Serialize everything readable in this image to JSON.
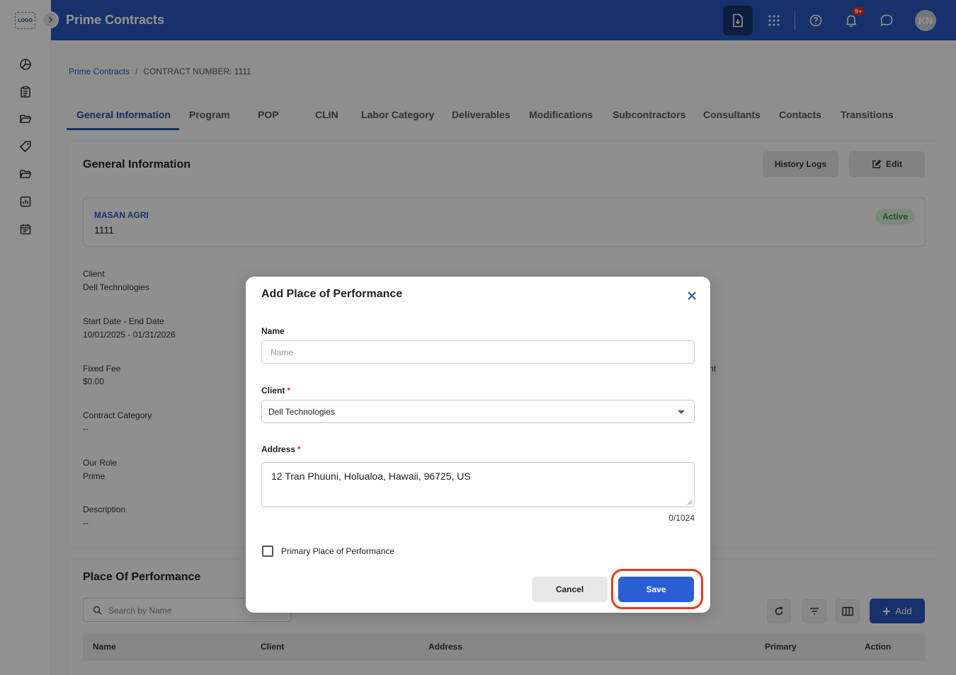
{
  "sidebar": {
    "logo_text": "LOGO",
    "icons": [
      "pie-chart-icon",
      "clipboard-icon",
      "folder-open-icon",
      "tag-icon",
      "folder-icon",
      "bar-chart-icon",
      "calendar-icon"
    ]
  },
  "header": {
    "title": "Prime Contracts",
    "notification_badge": "9+",
    "avatar_initials": "KN",
    "color": "#2755b8"
  },
  "breadcrumb": {
    "root": "Prime Contracts",
    "separator": "/",
    "current": "CONTRACT NUMBER: 1111"
  },
  "tabs": [
    {
      "label": "General Information",
      "active": true
    },
    {
      "label": "Program"
    },
    {
      "label": "POP"
    },
    {
      "label": "CLIN"
    },
    {
      "label": "Labor Category"
    },
    {
      "label": "Deliverables"
    },
    {
      "label": "Modifications"
    },
    {
      "label": "Subcontractors"
    },
    {
      "label": "Consultants"
    },
    {
      "label": "Contacts"
    },
    {
      "label": "Transitions"
    }
  ],
  "general_info": {
    "title": "General Information",
    "history_logs_label": "History Logs",
    "edit_label": "Edit",
    "company_name": "MASAN AGRI",
    "contract_number": "1111",
    "status": "Active",
    "fields": [
      {
        "label": "Client",
        "value": "Dell Technologies"
      },
      {
        "label": "Start Date - End Date",
        "value": "10/01/2025 - 01/31/2026"
      },
      {
        "label": "Fixed Fee",
        "value": "$0.00"
      },
      {
        "label": "Contract Category",
        "value": "--"
      },
      {
        "label": "Our Role",
        "value": "Prime"
      },
      {
        "label": "Description",
        "value": "--"
      }
    ],
    "right_fragment": "nt"
  },
  "pop_section": {
    "title": "Place Of Performance",
    "search_placeholder": "Search by Name",
    "add_label": "Add",
    "columns": [
      "Name",
      "Client",
      "Address",
      "Primary",
      "Action"
    ]
  },
  "modal": {
    "title": "Add Place of Performance",
    "name_label": "Name",
    "name_placeholder": "Name",
    "client_label": "Client",
    "client_value": "Dell Technologies",
    "address_label": "Address",
    "address_value": "12 Tran Phuuni, Holualoa, Hawaii, 96725, US",
    "counter": "0/1024",
    "required_mark": "*",
    "primary_label": "Primary Place of Performance",
    "primary_checked": false,
    "cancel_label": "Cancel",
    "save_label": "Save",
    "save_color": "#2b5ed4",
    "highlight_color": "#e53a1e"
  }
}
